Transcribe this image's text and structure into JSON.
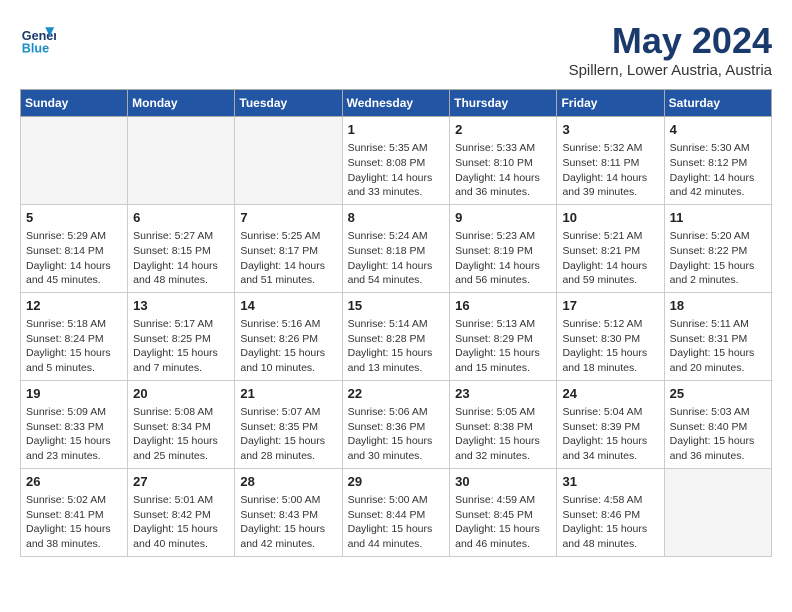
{
  "header": {
    "logo_line1": "General",
    "logo_line2": "Blue",
    "month_title": "May 2024",
    "location": "Spillern, Lower Austria, Austria"
  },
  "weekdays": [
    "Sunday",
    "Monday",
    "Tuesday",
    "Wednesday",
    "Thursday",
    "Friday",
    "Saturday"
  ],
  "weeks": [
    [
      {
        "day": "",
        "info": ""
      },
      {
        "day": "",
        "info": ""
      },
      {
        "day": "",
        "info": ""
      },
      {
        "day": "1",
        "info": "Sunrise: 5:35 AM\nSunset: 8:08 PM\nDaylight: 14 hours\nand 33 minutes."
      },
      {
        "day": "2",
        "info": "Sunrise: 5:33 AM\nSunset: 8:10 PM\nDaylight: 14 hours\nand 36 minutes."
      },
      {
        "day": "3",
        "info": "Sunrise: 5:32 AM\nSunset: 8:11 PM\nDaylight: 14 hours\nand 39 minutes."
      },
      {
        "day": "4",
        "info": "Sunrise: 5:30 AM\nSunset: 8:12 PM\nDaylight: 14 hours\nand 42 minutes."
      }
    ],
    [
      {
        "day": "5",
        "info": "Sunrise: 5:29 AM\nSunset: 8:14 PM\nDaylight: 14 hours\nand 45 minutes."
      },
      {
        "day": "6",
        "info": "Sunrise: 5:27 AM\nSunset: 8:15 PM\nDaylight: 14 hours\nand 48 minutes."
      },
      {
        "day": "7",
        "info": "Sunrise: 5:25 AM\nSunset: 8:17 PM\nDaylight: 14 hours\nand 51 minutes."
      },
      {
        "day": "8",
        "info": "Sunrise: 5:24 AM\nSunset: 8:18 PM\nDaylight: 14 hours\nand 54 minutes."
      },
      {
        "day": "9",
        "info": "Sunrise: 5:23 AM\nSunset: 8:19 PM\nDaylight: 14 hours\nand 56 minutes."
      },
      {
        "day": "10",
        "info": "Sunrise: 5:21 AM\nSunset: 8:21 PM\nDaylight: 14 hours\nand 59 minutes."
      },
      {
        "day": "11",
        "info": "Sunrise: 5:20 AM\nSunset: 8:22 PM\nDaylight: 15 hours\nand 2 minutes."
      }
    ],
    [
      {
        "day": "12",
        "info": "Sunrise: 5:18 AM\nSunset: 8:24 PM\nDaylight: 15 hours\nand 5 minutes."
      },
      {
        "day": "13",
        "info": "Sunrise: 5:17 AM\nSunset: 8:25 PM\nDaylight: 15 hours\nand 7 minutes."
      },
      {
        "day": "14",
        "info": "Sunrise: 5:16 AM\nSunset: 8:26 PM\nDaylight: 15 hours\nand 10 minutes."
      },
      {
        "day": "15",
        "info": "Sunrise: 5:14 AM\nSunset: 8:28 PM\nDaylight: 15 hours\nand 13 minutes."
      },
      {
        "day": "16",
        "info": "Sunrise: 5:13 AM\nSunset: 8:29 PM\nDaylight: 15 hours\nand 15 minutes."
      },
      {
        "day": "17",
        "info": "Sunrise: 5:12 AM\nSunset: 8:30 PM\nDaylight: 15 hours\nand 18 minutes."
      },
      {
        "day": "18",
        "info": "Sunrise: 5:11 AM\nSunset: 8:31 PM\nDaylight: 15 hours\nand 20 minutes."
      }
    ],
    [
      {
        "day": "19",
        "info": "Sunrise: 5:09 AM\nSunset: 8:33 PM\nDaylight: 15 hours\nand 23 minutes."
      },
      {
        "day": "20",
        "info": "Sunrise: 5:08 AM\nSunset: 8:34 PM\nDaylight: 15 hours\nand 25 minutes."
      },
      {
        "day": "21",
        "info": "Sunrise: 5:07 AM\nSunset: 8:35 PM\nDaylight: 15 hours\nand 28 minutes."
      },
      {
        "day": "22",
        "info": "Sunrise: 5:06 AM\nSunset: 8:36 PM\nDaylight: 15 hours\nand 30 minutes."
      },
      {
        "day": "23",
        "info": "Sunrise: 5:05 AM\nSunset: 8:38 PM\nDaylight: 15 hours\nand 32 minutes."
      },
      {
        "day": "24",
        "info": "Sunrise: 5:04 AM\nSunset: 8:39 PM\nDaylight: 15 hours\nand 34 minutes."
      },
      {
        "day": "25",
        "info": "Sunrise: 5:03 AM\nSunset: 8:40 PM\nDaylight: 15 hours\nand 36 minutes."
      }
    ],
    [
      {
        "day": "26",
        "info": "Sunrise: 5:02 AM\nSunset: 8:41 PM\nDaylight: 15 hours\nand 38 minutes."
      },
      {
        "day": "27",
        "info": "Sunrise: 5:01 AM\nSunset: 8:42 PM\nDaylight: 15 hours\nand 40 minutes."
      },
      {
        "day": "28",
        "info": "Sunrise: 5:00 AM\nSunset: 8:43 PM\nDaylight: 15 hours\nand 42 minutes."
      },
      {
        "day": "29",
        "info": "Sunrise: 5:00 AM\nSunset: 8:44 PM\nDaylight: 15 hours\nand 44 minutes."
      },
      {
        "day": "30",
        "info": "Sunrise: 4:59 AM\nSunset: 8:45 PM\nDaylight: 15 hours\nand 46 minutes."
      },
      {
        "day": "31",
        "info": "Sunrise: 4:58 AM\nSunset: 8:46 PM\nDaylight: 15 hours\nand 48 minutes."
      },
      {
        "day": "",
        "info": ""
      }
    ]
  ]
}
